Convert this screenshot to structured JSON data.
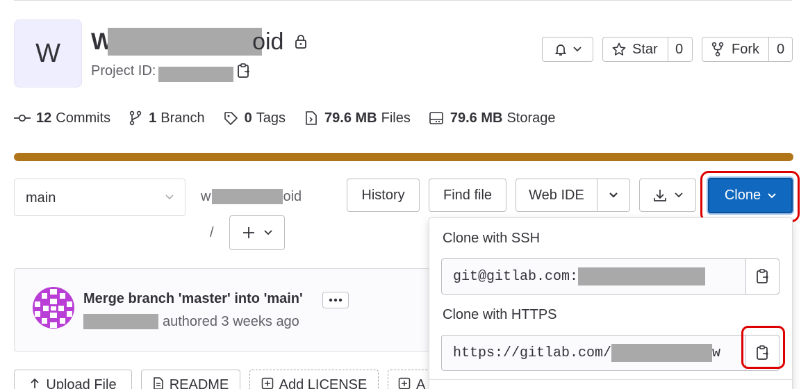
{
  "project": {
    "avatar_letter": "W",
    "name_prefix": "W",
    "name_suffix": "oid",
    "id_label": "Project ID:"
  },
  "actions": {
    "star_label": "Star",
    "star_count": "0",
    "fork_label": "Fork",
    "fork_count": "0"
  },
  "stats": {
    "commits_count": "12",
    "commits_label": "Commits",
    "branch_count": "1",
    "branch_label": "Branch",
    "tags_count": "0",
    "tags_label": "Tags",
    "files_size": "79.6 MB",
    "files_label": "Files",
    "storage_size": "79.6 MB",
    "storage_label": "Storage"
  },
  "storage_bar": {
    "color": "#b07419",
    "fill_fraction": 1.0
  },
  "toolbar": {
    "branch_value": "main",
    "path_prefix": "w",
    "path_suffix": "oid",
    "path_separator": "/",
    "history_label": "History",
    "find_file_label": "Find file",
    "web_ide_label": "Web IDE",
    "clone_label": "Clone"
  },
  "commit": {
    "title": "Merge branch 'master' into 'main'",
    "authored_text": "authored 3 weeks ago"
  },
  "clone_dropdown": {
    "ssh_label": "Clone with SSH",
    "ssh_prefix": "git@gitlab.com:",
    "https_label": "Clone with HTTPS",
    "https_prefix": "https://gitlab.com/",
    "https_suffix": "w"
  },
  "bottom_buttons": {
    "upload_label": "Upload File",
    "readme_label": "README",
    "license_label": "Add LICENSE",
    "fourth_label": "A"
  },
  "colors": {
    "clone_button": "#1068bf",
    "highlight": "#dd0000",
    "avatar_bg": "#eeeeff"
  }
}
